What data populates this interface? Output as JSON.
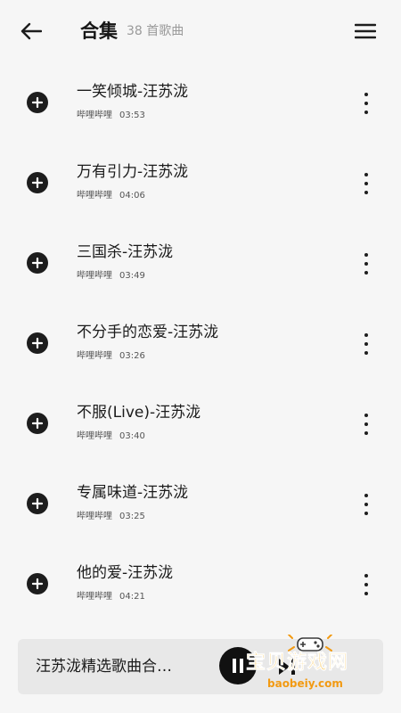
{
  "header": {
    "title": "合集",
    "subtitle": "38 首歌曲",
    "icons": {
      "back": "arrow-left-icon",
      "menu": "hamburger-menu-icon"
    }
  },
  "songs": [
    {
      "title": "一笑倾城-汪苏泷",
      "source": "哔哩哔哩",
      "duration": "03:53"
    },
    {
      "title": "万有引力-汪苏泷",
      "source": "哔哩哔哩",
      "duration": "04:06"
    },
    {
      "title": "三国杀-汪苏泷",
      "source": "哔哩哔哩",
      "duration": "03:49"
    },
    {
      "title": "不分手的恋爱-汪苏泷",
      "source": "哔哩哔哩",
      "duration": "03:26"
    },
    {
      "title": "不服(Live)-汪苏泷",
      "source": "哔哩哔哩",
      "duration": "03:40"
    },
    {
      "title": "专属味道-汪苏泷",
      "source": "哔哩哔哩",
      "duration": "03:25"
    },
    {
      "title": "他的爱-汪苏泷",
      "source": "哔哩哔哩",
      "duration": "04:21"
    }
  ],
  "player": {
    "title": "汪苏泷精选歌曲合…",
    "state": "playing"
  },
  "watermark": {
    "text": "宝贝游戏网",
    "url": "baobeiy.com"
  },
  "colors": {
    "background": "#f6f6f6",
    "player_bar": "#e8e8e8",
    "icon": "#1d1d1d",
    "watermark": "#f7b21c"
  }
}
